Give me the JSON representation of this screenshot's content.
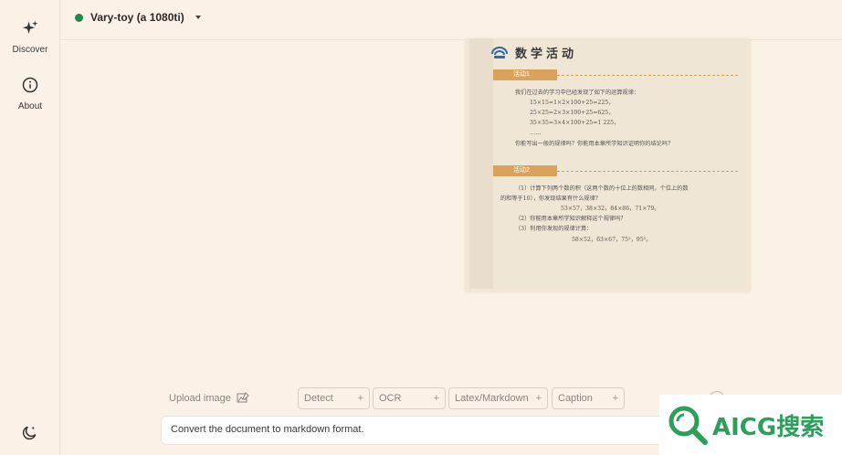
{
  "sidebar": {
    "items": [
      {
        "label": "Discover",
        "icon": "sparkle-icon"
      },
      {
        "label": "About",
        "icon": "info-icon"
      }
    ],
    "theme_icon": "moon-icon"
  },
  "header": {
    "model_name": "Vary-toy (a 1080ti)",
    "status_color": "#1f8a4c"
  },
  "document": {
    "title": "数学活动",
    "section1_label": "活动1",
    "section1_lines": [
      "我们在过去的学习中已经发现了如下的运算规律：",
      "15×15=1×2×100+25=225，",
      "25×25=2×3×100+25=625，",
      "35×35=3×4×100+25=1 225，",
      "……",
      "你能写出一般的规律吗？你能用本章所学知识证明你的结论吗？"
    ],
    "section2_label": "活动2",
    "section2_lines": [
      "（1）计算下列两个数的积（这两个数的十位上的数相同，个位上的数",
      "的和等于10），你发现结果有什么规律？",
      "53×57，38×32，84×86，71×79。",
      "（2）你能用本章所学知识解释这个规律吗？",
      "（3）利用你发现的规律计算：",
      "58×52，63×67，75²，95²。"
    ]
  },
  "toolbar": {
    "upload_label": "Upload image",
    "modes": [
      "Detect",
      "OCR",
      "Latex/Markdown",
      "Caption"
    ]
  },
  "prompt": {
    "value": "Convert the document to markdown format."
  },
  "watermark": {
    "text": "AICG搜索"
  }
}
